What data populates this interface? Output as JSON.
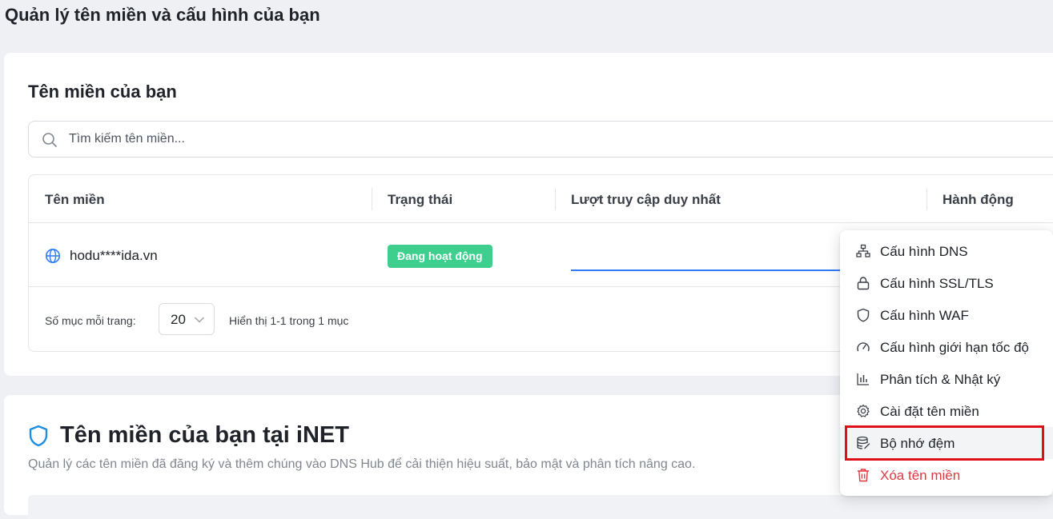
{
  "page": {
    "title": "Quản lý tên miền và cấu hình của bạn"
  },
  "domains_card": {
    "title": "Tên miền của bạn",
    "search": {
      "placeholder": "Tìm kiếm tên miền...",
      "value": ""
    },
    "table": {
      "columns": [
        "Tên miền",
        "Trạng thái",
        "Lượt truy cập duy nhất",
        "Hành động"
      ],
      "rows": [
        {
          "domain": "hodu****ida.vn",
          "status": "Đang hoạt động"
        }
      ]
    },
    "pagination": {
      "per_page_label": "Số mục mỗi trang:",
      "per_page_value": "20",
      "range_text": "Hiển thị 1-1 trong 1 mục"
    }
  },
  "inet_card": {
    "title": "Tên miền của bạn tại iNET",
    "description": "Quản lý các tên miền đã đăng ký và thêm chúng vào DNS Hub để cải thiện hiệu suất, bảo mật và phân tích nâng cao."
  },
  "action_menu": {
    "items": [
      {
        "label": "Cấu hình DNS",
        "icon": "sitemap-icon"
      },
      {
        "label": "Cấu hình SSL/TLS",
        "icon": "lock-icon"
      },
      {
        "label": "Cấu hình WAF",
        "icon": "shield-icon"
      },
      {
        "label": "Cấu hình giới hạn tốc độ",
        "icon": "gauge-icon"
      },
      {
        "label": "Phân tích & Nhật ký",
        "icon": "bar-chart-icon"
      },
      {
        "label": "Cài đặt tên miền",
        "icon": "gear-icon"
      },
      {
        "label": "Bộ nhớ đệm",
        "icon": "database-icon"
      },
      {
        "label": "Xóa tên miền",
        "icon": "trash-icon"
      }
    ],
    "highlighted_item": "Bộ nhớ đệm"
  },
  "colors": {
    "accent": "#2f7cf6",
    "status_active": "#3ecf8e",
    "danger": "#e0383e",
    "highlight_border": "#e0101a"
  }
}
